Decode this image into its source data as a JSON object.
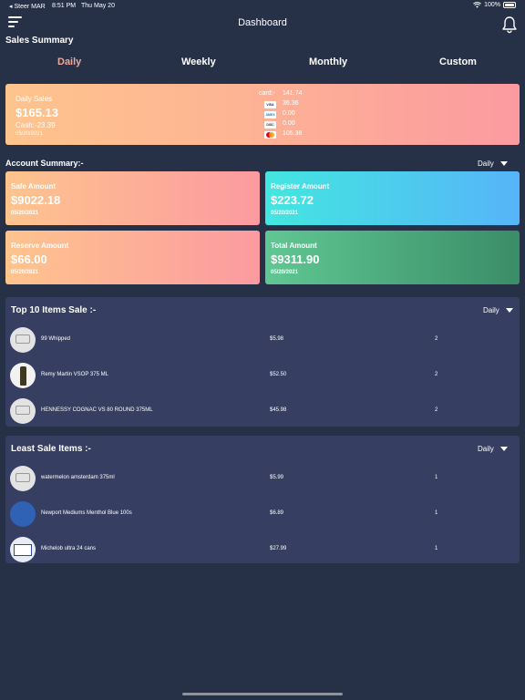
{
  "status_bar": {
    "carrier": "◂ Steer MAR",
    "time": "8:51 PM",
    "date": "Thu May 20",
    "battery": "100%"
  },
  "header": {
    "title": "Dashboard"
  },
  "sales_summary": {
    "title": "Sales Summary",
    "tabs": [
      {
        "label": "Daily",
        "active": true
      },
      {
        "label": "Weekly"
      },
      {
        "label": "Monthly"
      },
      {
        "label": "Custom"
      }
    ],
    "card": {
      "label": "Daily Sales",
      "amount": "$165.13",
      "cash": "Cash:-23.39",
      "date": "05/20/2021",
      "card_label": "card:-",
      "card_total": "141.74",
      "payments": [
        {
          "icon": "visa-icon",
          "value": "36.36"
        },
        {
          "icon": "amex-icon",
          "value": "0.00"
        },
        {
          "icon": "discover-icon",
          "value": "0.00"
        },
        {
          "icon": "mastercard-icon",
          "value": "105.38"
        }
      ]
    }
  },
  "account_summary": {
    "title": "Account Summary:-",
    "filter": "Daily",
    "cards": [
      {
        "label": "Safe Amount",
        "amount": "$9022.18",
        "date": "05/20/2021"
      },
      {
        "label": "Register Amount",
        "amount": "$223.72",
        "date": "05/20/2021"
      },
      {
        "label": "Reserve Amount",
        "amount": "$66.00",
        "date": "05/20/2021"
      },
      {
        "label": "Total  Amount",
        "amount": "$9311.90",
        "date": "05/20/2021"
      }
    ]
  },
  "top_items": {
    "title": "Top 10 Items Sale :-",
    "filter": "Daily",
    "rows": [
      {
        "name": "99 Whipped",
        "price": "$5.98",
        "qty": "2"
      },
      {
        "name": "Remy Martin VSOP 375 ML",
        "price": "$52.50",
        "qty": "2"
      },
      {
        "name": "HENNESSY COGNAC VS 80 ROUND 375ML",
        "price": "$45.98",
        "qty": "2"
      }
    ]
  },
  "least_items": {
    "title": "Least Sale Items :-",
    "filter": "Daily",
    "rows": [
      {
        "name": "watermelon amsterdam 375ml",
        "price": "$5.99",
        "qty": "1"
      },
      {
        "name": "Newport Mediums Menthol Blue 100s",
        "price": "$6.89",
        "qty": "1"
      },
      {
        "name": "Michelob ultra 24 cans",
        "price": "$27.99",
        "qty": "1"
      }
    ]
  },
  "colors": {
    "background": "#263148",
    "panel": "#363f62",
    "active_tab": "#e9a99a"
  }
}
